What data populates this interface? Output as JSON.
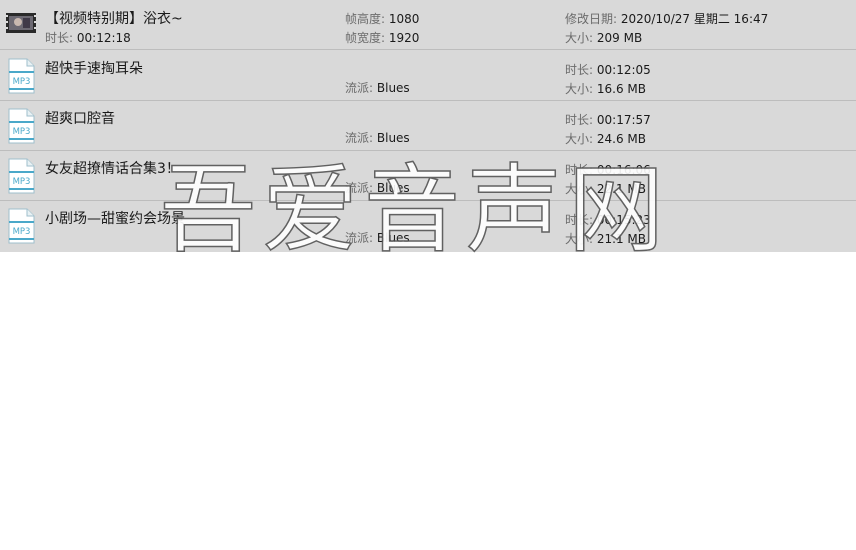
{
  "items": [
    {
      "name": "【视频特别期】浴衣~",
      "type": "video",
      "fields": [
        {
          "label": "时长:",
          "value": "00:12:18"
        },
        {
          "label": "帧高度:",
          "value": "1080"
        },
        {
          "label": "帧宽度:",
          "value": "1920"
        },
        {
          "label": "修改日期:",
          "value": "2020/10/27 星期二 16:47"
        },
        {
          "label": "大小:",
          "value": "209 MB"
        }
      ]
    },
    {
      "name": "超快手速掏耳朵",
      "type": "mp3",
      "icon_label": "MP3",
      "fields": [
        {
          "label": "流派:",
          "value": "Blues"
        },
        {
          "label": "时长:",
          "value": "00:12:05"
        },
        {
          "label": "大小:",
          "value": "16.6 MB"
        }
      ]
    },
    {
      "name": "超爽口腔音",
      "type": "mp3",
      "icon_label": "MP3",
      "fields": [
        {
          "label": "流派:",
          "value": "Blues"
        },
        {
          "label": "时长:",
          "value": "00:17:57"
        },
        {
          "label": "大小:",
          "value": "24.6 MB"
        }
      ]
    },
    {
      "name": "女友超撩情话合集3！",
      "type": "mp3",
      "icon_label": "MP3",
      "fields": [
        {
          "label": "流派:",
          "value": "Blues"
        },
        {
          "label": "时长:",
          "value": "00:16:06"
        },
        {
          "label": "大小:",
          "value": "22.1 MB"
        }
      ]
    },
    {
      "name": "小剧场—甜蜜约会场景",
      "type": "mp3",
      "icon_label": "MP3",
      "fields": [
        {
          "label": "流派:",
          "value": "Blues"
        },
        {
          "label": "时长:",
          "value": "00:15:23"
        },
        {
          "label": "大小:",
          "value": "21.1 MB"
        }
      ]
    }
  ],
  "watermark": "吾爱音声网",
  "colors": {
    "row_bg": "#d9d9d9",
    "divider": "#bdbdbd",
    "label": "#6b6b6b",
    "mp3_accent": "#4aa8c9"
  }
}
